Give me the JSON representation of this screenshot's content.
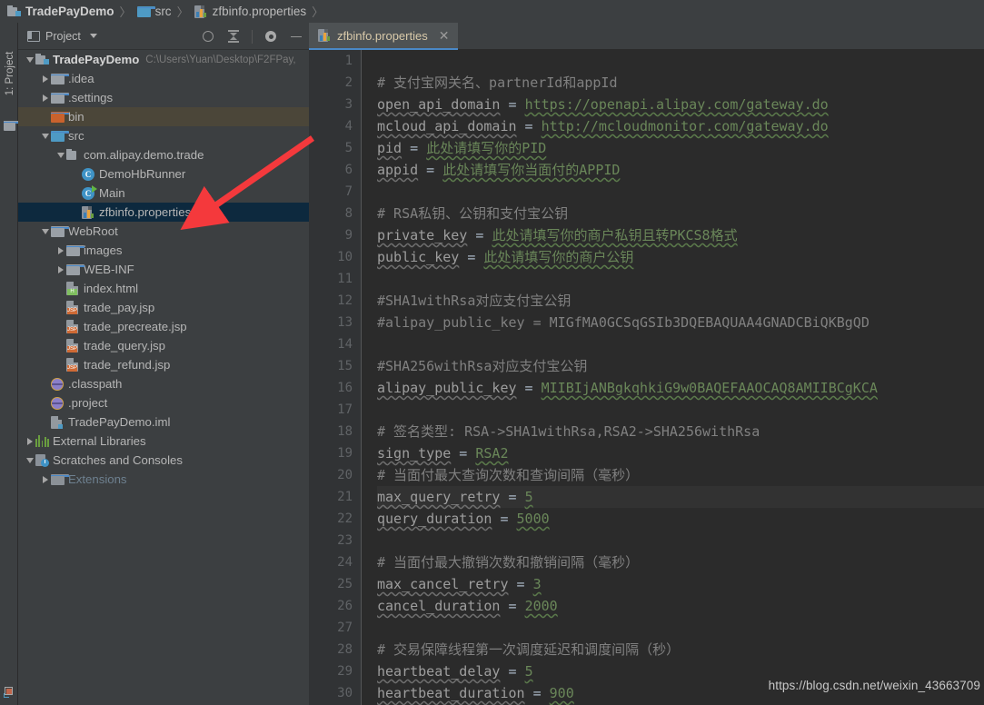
{
  "breadcrumb": {
    "items": [
      {
        "label": "TradePayDemo",
        "icon": "module-icon",
        "bold": true
      },
      {
        "label": "src",
        "icon": "folder-icon",
        "bold": false
      },
      {
        "label": "zfbinfo.properties",
        "icon": "properties-file-icon",
        "bold": false
      }
    ],
    "separator": "〉"
  },
  "tool_strip": {
    "project_tab_label": "1: Project",
    "folder_icon": "folder-icon",
    "bottom_icon": "terminal-icon"
  },
  "project_panel": {
    "title": "Project",
    "window_icon": "window-icon",
    "dropdown_icon": "chevron-down-icon",
    "actions": [
      {
        "name": "select-opened-file-button",
        "icon": "target-icon"
      },
      {
        "name": "collapse-all-button",
        "icon": "collapse-all-icon"
      },
      {
        "name": "settings-button",
        "icon": "gear-icon"
      },
      {
        "name": "hide-button",
        "icon": "minimize-icon"
      }
    ],
    "tree": [
      {
        "label": "TradePayDemo",
        "suffix": "C:\\Users\\Yuan\\Desktop\\F2FPay,",
        "indent": 0,
        "toggle": "down",
        "icon": "module-icon",
        "bold": true,
        "state": "normal"
      },
      {
        "label": ".idea",
        "suffix": "",
        "indent": 1,
        "toggle": "right",
        "icon": "folder-grey-icon",
        "bold": false,
        "state": "normal"
      },
      {
        "label": ".settings",
        "suffix": "",
        "indent": 1,
        "toggle": "right",
        "icon": "folder-grey-icon",
        "bold": false,
        "state": "normal"
      },
      {
        "label": "bin",
        "suffix": "",
        "indent": 1,
        "toggle": "none",
        "icon": "folder-orange-icon",
        "bold": false,
        "state": "hover"
      },
      {
        "label": "src",
        "suffix": "",
        "indent": 1,
        "toggle": "down",
        "icon": "folder-blue-icon",
        "bold": false,
        "state": "normal"
      },
      {
        "label": "com.alipay.demo.trade",
        "suffix": "",
        "indent": 2,
        "toggle": "down",
        "icon": "package-icon",
        "bold": false,
        "state": "normal"
      },
      {
        "label": "DemoHbRunner",
        "suffix": "",
        "indent": 3,
        "toggle": "none",
        "icon": "java-class-icon",
        "bold": false,
        "state": "normal"
      },
      {
        "label": "Main",
        "suffix": "",
        "indent": 3,
        "toggle": "none",
        "icon": "java-class-runnable-icon",
        "bold": false,
        "state": "normal"
      },
      {
        "label": "zfbinfo.properties",
        "suffix": "",
        "indent": 3,
        "toggle": "none",
        "icon": "properties-file-icon",
        "bold": false,
        "state": "selected"
      },
      {
        "label": "WebRoot",
        "suffix": "",
        "indent": 1,
        "toggle": "down",
        "icon": "folder-grey-icon",
        "bold": false,
        "state": "normal"
      },
      {
        "label": "images",
        "suffix": "",
        "indent": 2,
        "toggle": "right",
        "icon": "folder-grey-icon",
        "bold": false,
        "state": "normal"
      },
      {
        "label": "WEB-INF",
        "suffix": "",
        "indent": 2,
        "toggle": "right",
        "icon": "folder-grey-icon",
        "bold": false,
        "state": "normal"
      },
      {
        "label": "index.html",
        "suffix": "",
        "indent": 2,
        "toggle": "none",
        "icon": "html-file-icon",
        "bold": false,
        "state": "normal"
      },
      {
        "label": "trade_pay.jsp",
        "suffix": "",
        "indent": 2,
        "toggle": "none",
        "icon": "jsp-file-icon",
        "bold": false,
        "state": "normal"
      },
      {
        "label": "trade_precreate.jsp",
        "suffix": "",
        "indent": 2,
        "toggle": "none",
        "icon": "jsp-file-icon",
        "bold": false,
        "state": "normal"
      },
      {
        "label": "trade_query.jsp",
        "suffix": "",
        "indent": 2,
        "toggle": "none",
        "icon": "jsp-file-icon",
        "bold": false,
        "state": "normal"
      },
      {
        "label": "trade_refund.jsp",
        "suffix": "",
        "indent": 2,
        "toggle": "none",
        "icon": "jsp-file-icon",
        "bold": false,
        "state": "normal"
      },
      {
        "label": ".classpath",
        "suffix": "",
        "indent": 1,
        "toggle": "none",
        "icon": "disc-file-icon",
        "bold": false,
        "state": "normal"
      },
      {
        "label": ".project",
        "suffix": "",
        "indent": 1,
        "toggle": "none",
        "icon": "disc-file-icon",
        "bold": false,
        "state": "normal"
      },
      {
        "label": "TradePayDemo.iml",
        "suffix": "",
        "indent": 1,
        "toggle": "none",
        "icon": "iml-file-icon",
        "bold": false,
        "state": "normal"
      },
      {
        "label": "External Libraries",
        "suffix": "",
        "indent": 0,
        "toggle": "right",
        "icon": "libraries-icon",
        "bold": false,
        "state": "normal"
      },
      {
        "label": "Scratches and Consoles",
        "suffix": "",
        "indent": 0,
        "toggle": "down",
        "icon": "scratches-icon",
        "bold": false,
        "state": "normal"
      },
      {
        "label": "Extensions",
        "suffix": "",
        "indent": 1,
        "toggle": "right",
        "icon": "folder-dim-icon",
        "bold": false,
        "state": "dim"
      }
    ]
  },
  "editor": {
    "tab": {
      "label": "zfbinfo.properties",
      "icon": "properties-file-icon",
      "close_icon": "close-icon"
    },
    "caret_line": 21,
    "line_numbers": [
      1,
      2,
      3,
      4,
      5,
      6,
      7,
      8,
      9,
      10,
      11,
      12,
      13,
      14,
      15,
      16,
      17,
      18,
      19,
      20,
      21,
      22,
      23,
      24,
      25,
      26,
      27,
      28,
      29,
      30
    ],
    "lines": [
      {
        "n": 1,
        "type": "blank",
        "text": ""
      },
      {
        "n": 2,
        "type": "comment",
        "text": "# 支付宝网关名、partnerId和appId"
      },
      {
        "n": 3,
        "type": "kv",
        "key": "open_api_domain",
        "value": "https://openapi.alipay.com/gateway.do"
      },
      {
        "n": 4,
        "type": "kv",
        "key": "mcloud_api_domain",
        "value": "http://mcloudmonitor.com/gateway.do"
      },
      {
        "n": 5,
        "type": "kv",
        "key": "pid",
        "value": "此处请填写你的PID"
      },
      {
        "n": 6,
        "type": "kv",
        "key": "appid",
        "value": "此处请填写你当面付的APPID"
      },
      {
        "n": 7,
        "type": "blank",
        "text": ""
      },
      {
        "n": 8,
        "type": "comment",
        "text": "# RSA私钥、公钥和支付宝公钥"
      },
      {
        "n": 9,
        "type": "kv",
        "key": "private_key",
        "value": "此处请填写你的商户私钥且转PKCS8格式"
      },
      {
        "n": 10,
        "type": "kv",
        "key": "public_key",
        "value": "此处请填写你的商户公钥"
      },
      {
        "n": 11,
        "type": "blank",
        "text": ""
      },
      {
        "n": 12,
        "type": "comment",
        "text": "#SHA1withRsa对应支付宝公钥"
      },
      {
        "n": 13,
        "type": "comment",
        "text": "#alipay_public_key = MIGfMA0GCSqGSIb3DQEBAQUAA4GNADCBiQKBgQD"
      },
      {
        "n": 14,
        "type": "blank",
        "text": ""
      },
      {
        "n": 15,
        "type": "comment",
        "text": "#SHA256withRsa对应支付宝公钥"
      },
      {
        "n": 16,
        "type": "kv",
        "key": "alipay_public_key",
        "value": "MIIBIjANBgkqhkiG9w0BAQEFAAOCAQ8AMIIBCgKCA"
      },
      {
        "n": 17,
        "type": "blank",
        "text": ""
      },
      {
        "n": 18,
        "type": "comment",
        "text": "# 签名类型: RSA->SHA1withRsa,RSA2->SHA256withRsa"
      },
      {
        "n": 19,
        "type": "kv",
        "key": "sign_type",
        "value": "RSA2"
      },
      {
        "n": 20,
        "type": "comment",
        "text": "# 当面付最大查询次数和查询间隔（毫秒）"
      },
      {
        "n": 21,
        "type": "kv",
        "key": "max_query_retry",
        "value": "5"
      },
      {
        "n": 22,
        "type": "kv",
        "key": "query_duration",
        "value": "5000"
      },
      {
        "n": 23,
        "type": "blank",
        "text": ""
      },
      {
        "n": 24,
        "type": "comment",
        "text": "# 当面付最大撤销次数和撤销间隔（毫秒）"
      },
      {
        "n": 25,
        "type": "kv",
        "key": "max_cancel_retry",
        "value": "3"
      },
      {
        "n": 26,
        "type": "kv",
        "key": "cancel_duration",
        "value": "2000"
      },
      {
        "n": 27,
        "type": "blank",
        "text": ""
      },
      {
        "n": 28,
        "type": "comment",
        "text": "# 交易保障线程第一次调度延迟和调度间隔（秒）"
      },
      {
        "n": 29,
        "type": "kv",
        "key": "heartbeat_delay",
        "value": "5"
      },
      {
        "n": 30,
        "type": "kv",
        "key": "heartbeat_duration",
        "value": "900"
      }
    ]
  },
  "watermark": "https://blog.csdn.net/weixin_43663709",
  "colors": {
    "accent": "#4a88c7",
    "selection": "#0d293e",
    "hover": "#4b4639",
    "comment": "#808080",
    "value": "#6a8759",
    "annotation_arrow": "#f4393c"
  }
}
